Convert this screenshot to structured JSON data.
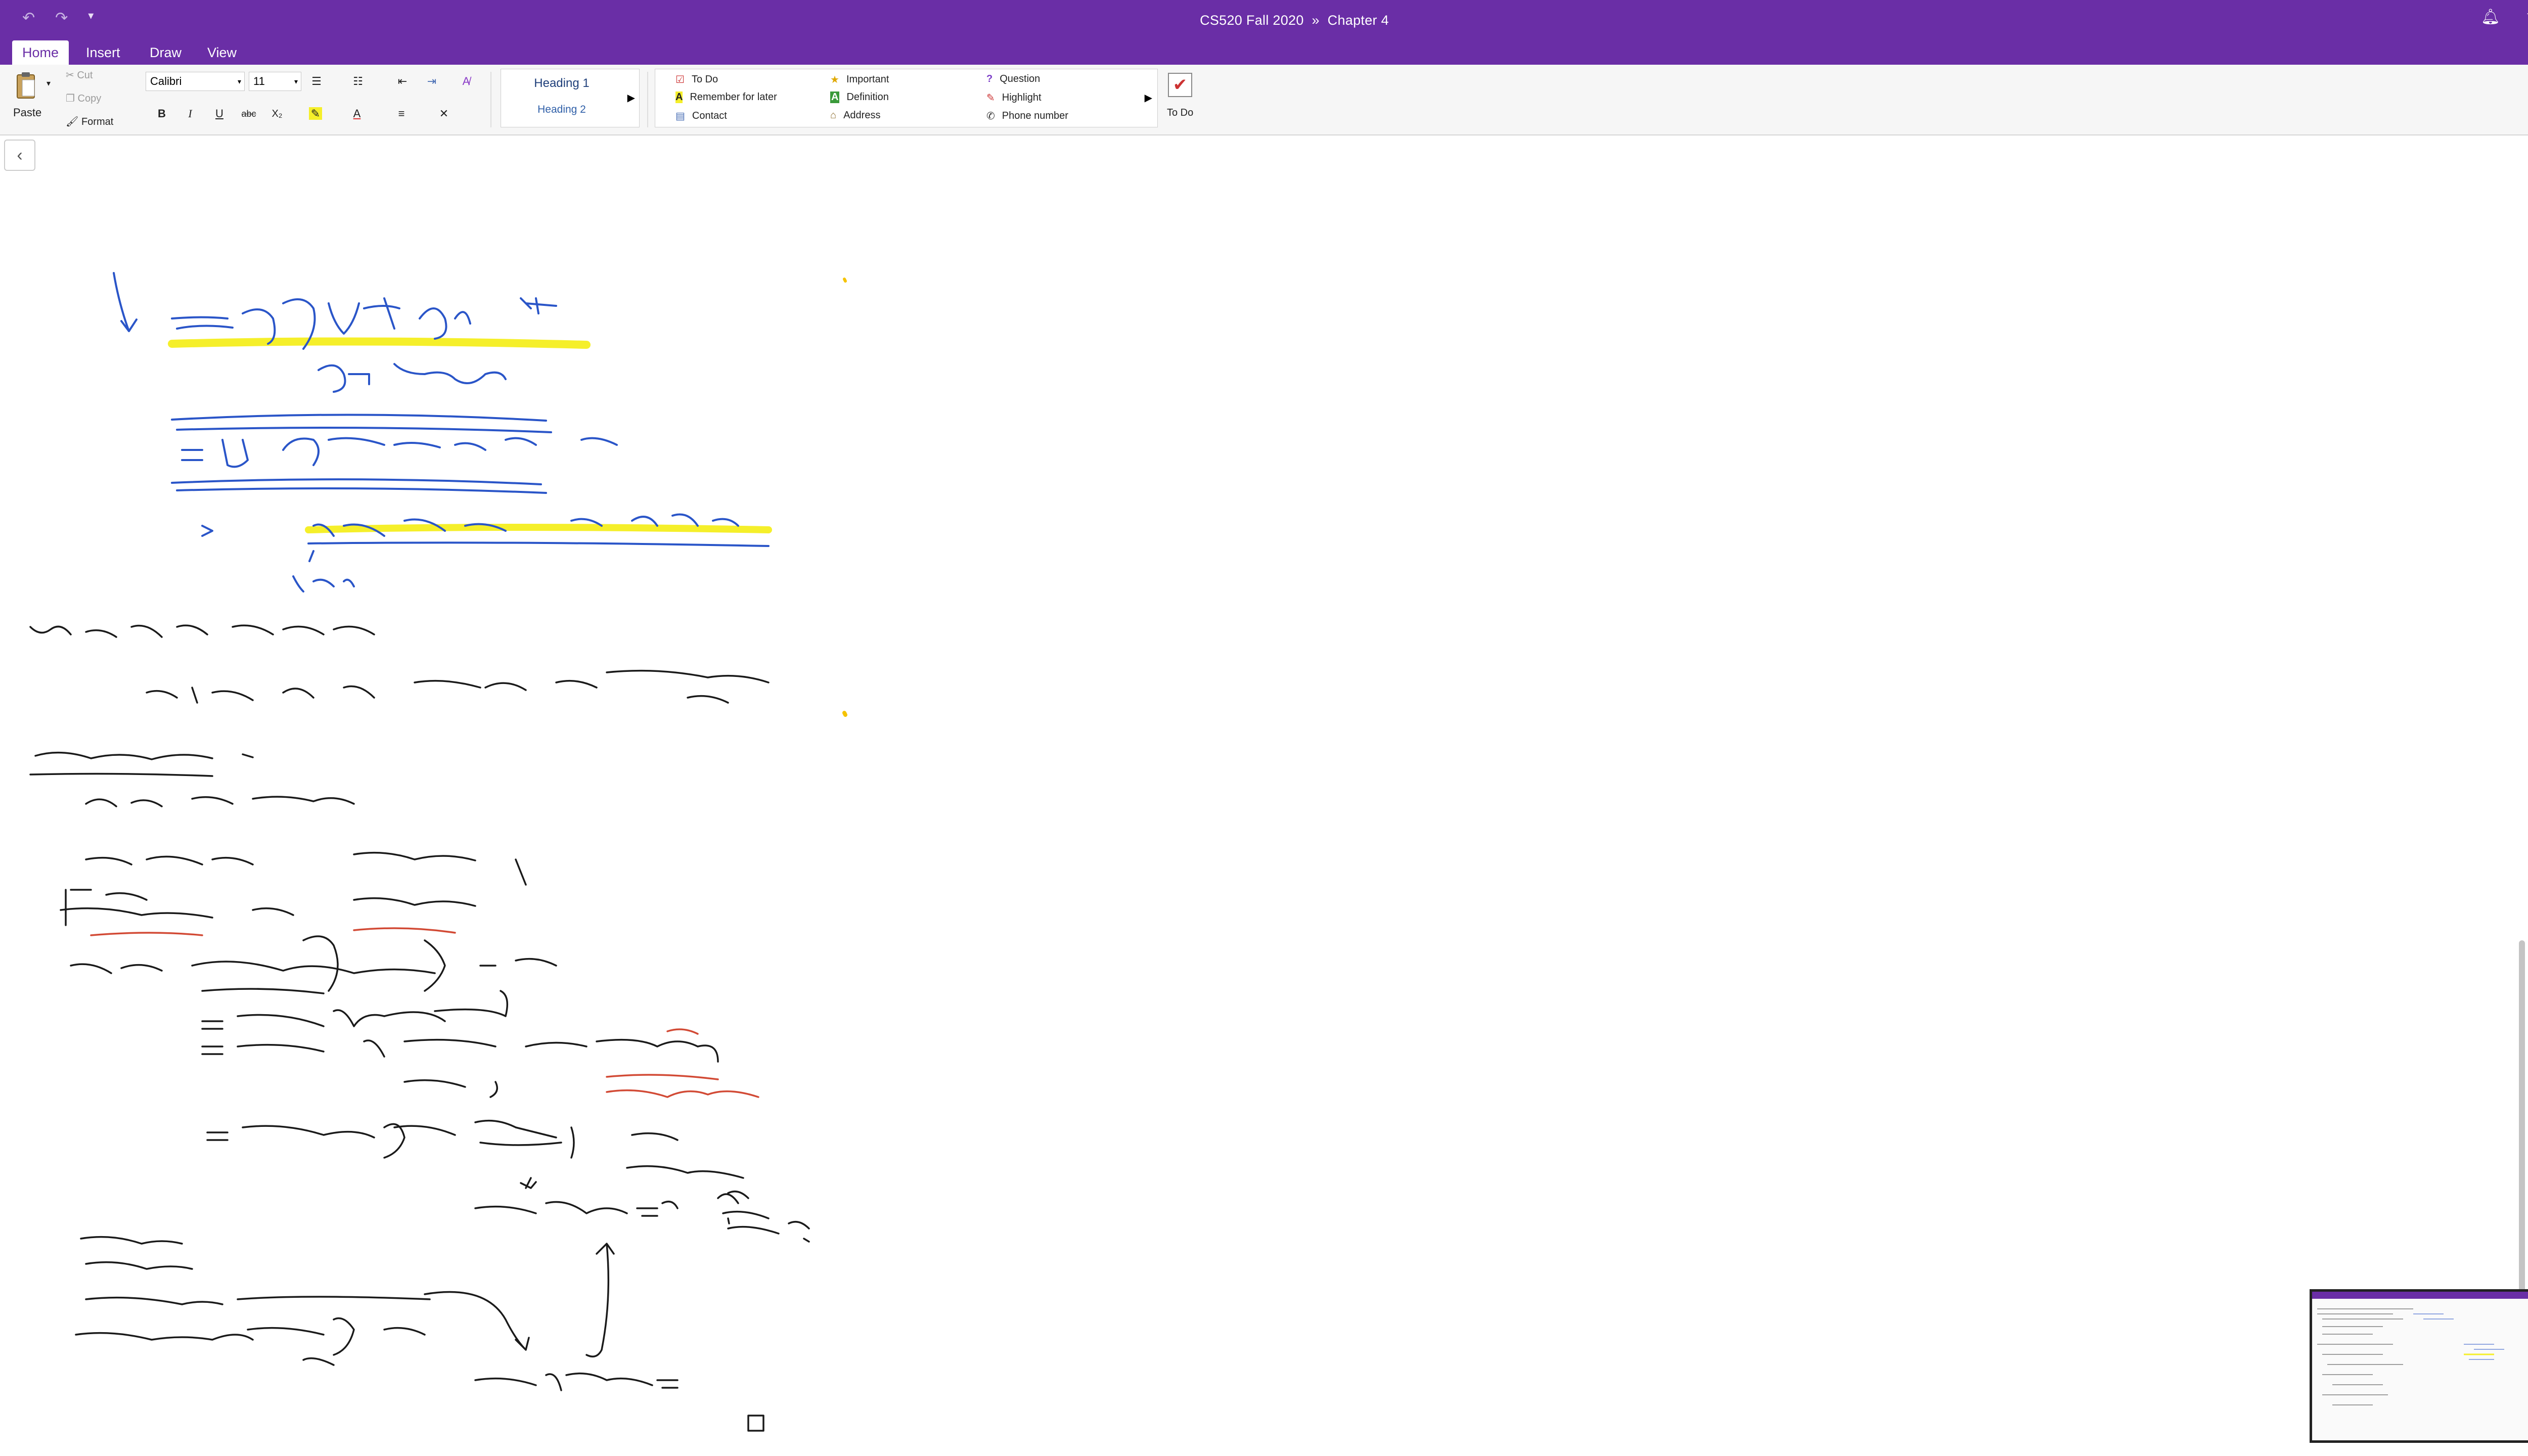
{
  "window": {
    "title": "CS520 Fall 2020",
    "separator": "»",
    "section": "Chapter 4"
  },
  "quick_access": {
    "undo_icon": "undo-icon",
    "redo_icon": "redo-icon",
    "customize_icon": "chevron-down-icon"
  },
  "tabs": [
    {
      "label": "Home",
      "active": true
    },
    {
      "label": "Insert",
      "active": false
    },
    {
      "label": "Draw",
      "active": false
    },
    {
      "label": "View",
      "active": false
    }
  ],
  "clipboard": {
    "paste": "Paste",
    "cut": "Cut",
    "copy": "Copy",
    "format": "Format"
  },
  "font": {
    "family": "Calibri",
    "size": "11"
  },
  "formatting": {
    "bold": "B",
    "italic": "I",
    "underline": "U",
    "strike": "abc",
    "subscript": "X₂",
    "font_color": "A"
  },
  "styles": {
    "heading1": "Heading 1",
    "heading2": "Heading 2"
  },
  "tags": [
    {
      "label": "To Do",
      "icon": "checkbox-icon"
    },
    {
      "label": "Remember for later",
      "icon": "highlighter-a-icon"
    },
    {
      "label": "Contact",
      "icon": "contact-card-icon"
    },
    {
      "label": "Important",
      "icon": "star-icon"
    },
    {
      "label": "Definition",
      "icon": "green-a-icon"
    },
    {
      "label": "Address",
      "icon": "house-icon"
    },
    {
      "label": "Question",
      "icon": "question-mark-icon"
    },
    {
      "label": "Highlight",
      "icon": "pen-icon"
    },
    {
      "label": "Phone number",
      "icon": "phone-icon"
    }
  ],
  "todo_button": {
    "label": "To Do"
  },
  "colors": {
    "accent": "#6a2ea6",
    "ink_blue": "#2a55c8",
    "ink_black": "#1a1a1a",
    "ink_red": "#d24a35",
    "highlight_yellow": "#f5ef2a"
  },
  "notes": {
    "line1": "What we prove: for all n≥0,",
    "line2": "for all σ ∈ Σ, if ⟦b⟧σ = tt, then ⟦while b do S⟧(Fⁿ(⊥)(σ)) ⊑ tt.",
    "line3": "Inductive case:",
    "line4": "Pick σ ∈ Σ s.t. ⟦b⟧σ = tt.",
    "line5": "Case analysis σ.",
    "line6": "Body of the loop",
    "line7": "To show:",
    "line8": "By I.H.",
    "line9": "By the assm.",
    "line10": "Yes ⇒ I.H.",
    "line11": "No ⇒ ?"
  }
}
